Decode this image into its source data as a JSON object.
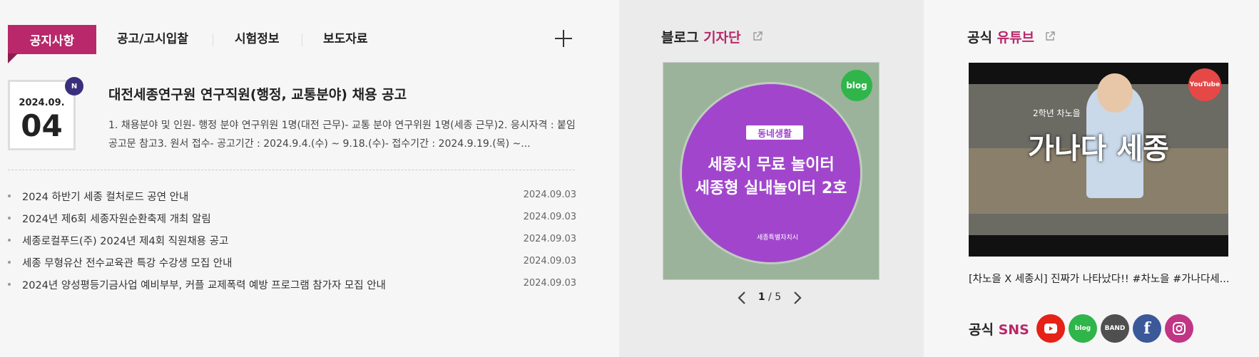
{
  "notice": {
    "tabs": [
      {
        "label": "공지사항"
      },
      {
        "label": "공고/고시입찰"
      },
      {
        "label": "시험정보"
      },
      {
        "label": "보도자료"
      }
    ],
    "featured": {
      "date_ym": "2024.09.",
      "date_d": "04",
      "badge": "N",
      "title": "대전세종연구원 연구직원(행정, 교통분야) 채용 공고",
      "summary": "1. 채용분야 및 인원- 행정 분야 연구위원 1명(대전 근무)- 교통 분야 연구위원 1명(세종 근무)2. 응시자격 : 붙임 공고문 참고3. 원서 접수- 공고기간 : 2024.9.4.(수) ~ 9.18.(수)- 접수기간 : 2024.9.19.(목) ~..."
    },
    "items": [
      {
        "title": "2024 하반기 세종 컬처로드 공연 안내",
        "date": "2024.09.03"
      },
      {
        "title": "2024년 제6회 세종자원순환축제 개최 알림",
        "date": "2024.09.03"
      },
      {
        "title": "세종로컬푸드(주) 2024년 제4회 직원채용 공고",
        "date": "2024.09.03"
      },
      {
        "title": "세종 무형유산 전수교육관 특강 수강생 모집 안내",
        "date": "2024.09.03"
      },
      {
        "title": "2024년 양성평등기금사업 예비부부, 커플 교제폭력 예방 프로그램 참가자 모집 안내",
        "date": "2024.09.03"
      }
    ]
  },
  "blog": {
    "title_prefix": "블로그",
    "title_accent": "기자단",
    "slide": {
      "tag": "동네생활",
      "line1": "세종시 무료 놀이터",
      "line2": "세종형 실내놀이터 2호",
      "badge": "blog",
      "mark": "세종특별자치시"
    },
    "pager": {
      "current": "1",
      "sep": "/",
      "total": "5"
    }
  },
  "youtube": {
    "title_prefix": "공식",
    "title_accent": "유튜브",
    "thumb": {
      "overlay": "가나다 세종",
      "note": "2학년 차노을",
      "badge": "YouTube"
    },
    "caption": "[차노을 X 세종시] 진짜가 나타났다!! #차노을 #가나다세..."
  },
  "sns": {
    "title_prefix": "공식",
    "title_accent": "SNS",
    "items": [
      {
        "name": "youtube",
        "label": "",
        "color": "#e62117"
      },
      {
        "name": "blog",
        "label": "blog",
        "color": "#2fb54a"
      },
      {
        "name": "band",
        "label": "BAND",
        "color": "#4f4f4f"
      },
      {
        "name": "facebook",
        "label": "f",
        "color": "#3b5998"
      },
      {
        "name": "instagram",
        "label": "",
        "color": "#c13584"
      }
    ]
  },
  "colors": {
    "accent": "#b8286a",
    "badge": "#3a2f7d"
  }
}
